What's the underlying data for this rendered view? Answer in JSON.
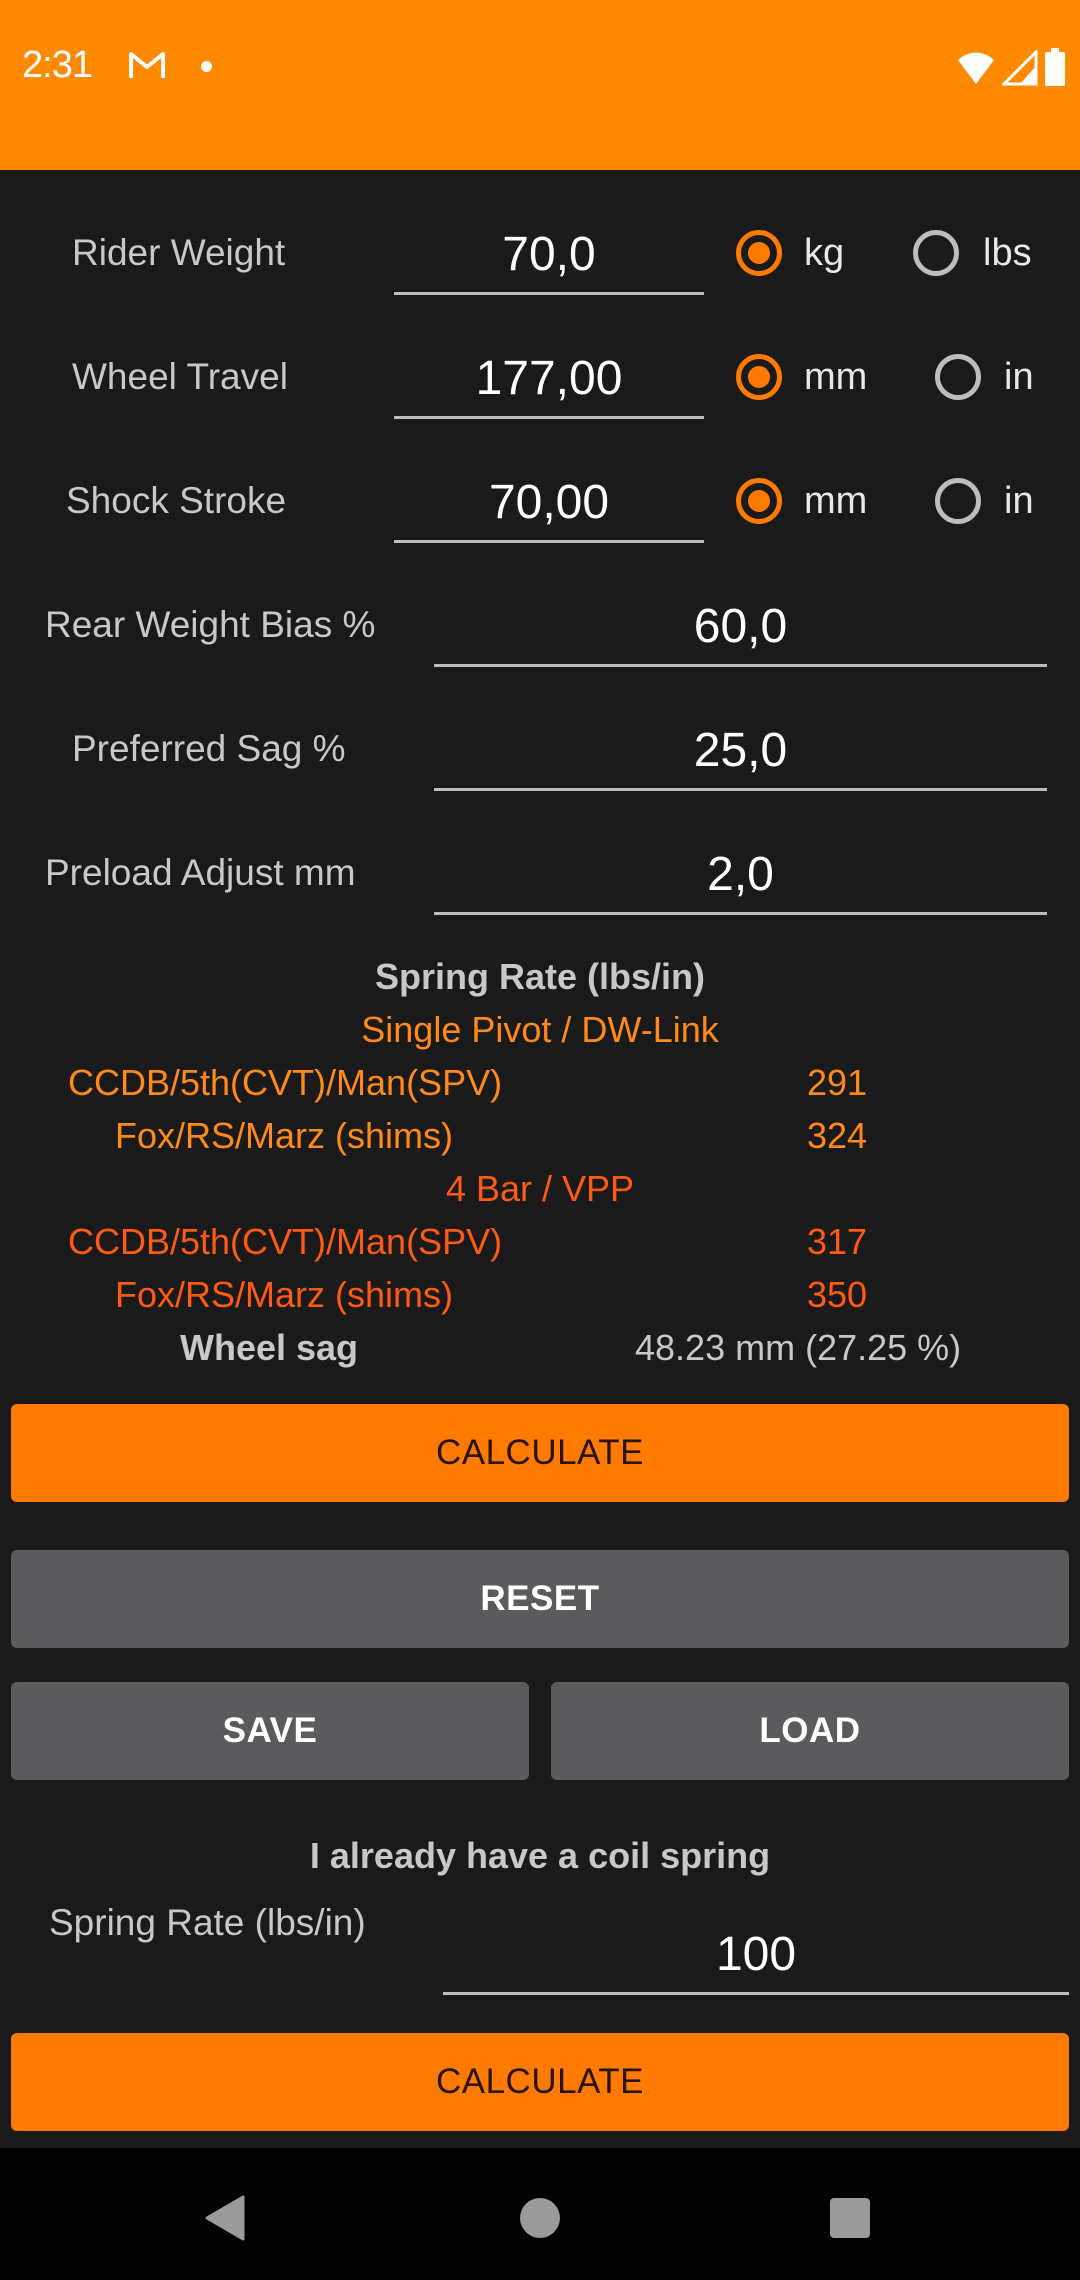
{
  "status_bar": {
    "time": "2:31",
    "notification_icons": [
      "gmail-icon",
      "dot-icon"
    ],
    "system_icons": [
      "wifi-icon",
      "cell-signal-icon",
      "battery-icon"
    ]
  },
  "inputs": {
    "rider_weight": {
      "label": "Rider Weight",
      "value": "70,0",
      "units": [
        {
          "label": "kg",
          "checked": true
        },
        {
          "label": "lbs",
          "checked": false
        }
      ]
    },
    "wheel_travel": {
      "label": "Wheel Travel",
      "value": "177,00",
      "units": [
        {
          "label": "mm",
          "checked": true
        },
        {
          "label": "in",
          "checked": false
        }
      ]
    },
    "shock_stroke": {
      "label": "Shock Stroke",
      "value": "70,00",
      "units": [
        {
          "label": "mm",
          "checked": true
        },
        {
          "label": "in",
          "checked": false
        }
      ]
    },
    "rear_weight_bias": {
      "label": "Rear Weight Bias %",
      "value": "60,0"
    },
    "preferred_sag": {
      "label": "Preferred Sag %",
      "value": "25,0"
    },
    "preload_adjust": {
      "label": "Preload Adjust mm",
      "value": "2,0"
    }
  },
  "results": {
    "title": "Spring Rate (lbs/in)",
    "groups": [
      {
        "title": "Single Pivot / DW-Link",
        "color": "#ff8a1a",
        "rows": [
          {
            "label": "CCDB/5th(CVT)/Man(SPV)",
            "value": "291"
          },
          {
            "label": "Fox/RS/Marz (shims)",
            "value": "324"
          }
        ]
      },
      {
        "title": "4 Bar / VPP",
        "color": "#ff5a14",
        "rows": [
          {
            "label": "CCDB/5th(CVT)/Man(SPV)",
            "value": "317"
          },
          {
            "label": "Fox/RS/Marz (shims)",
            "value": "350"
          }
        ]
      }
    ],
    "wheel_sag": {
      "label": "Wheel sag",
      "value": "48.23 mm (27.25 %)"
    }
  },
  "buttons": {
    "calculate": "CALCULATE",
    "reset": "RESET",
    "save": "SAVE",
    "load": "LOAD",
    "calculate_coil": "CALCULATE"
  },
  "coil_section": {
    "title": "I already have a coil spring",
    "spring_rate_label": "Spring Rate (lbs/in)",
    "spring_rate_value": "100"
  },
  "colors": {
    "accent": "#ff8a00",
    "button_primary": "#ff7a00",
    "button_secondary": "#5b5b5d",
    "background": "#1a1a1a"
  },
  "nav_bar": {
    "buttons": [
      "back-icon",
      "home-icon",
      "recents-icon"
    ]
  }
}
